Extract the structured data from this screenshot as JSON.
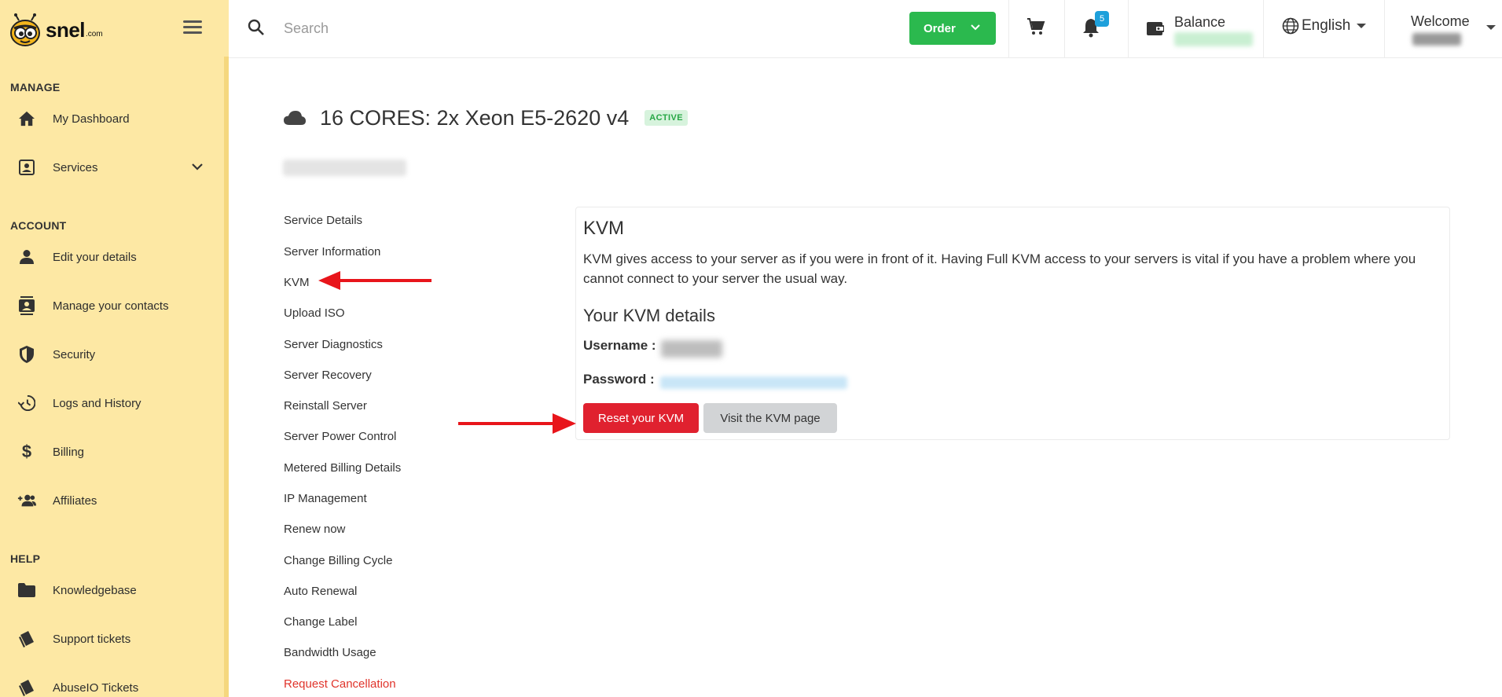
{
  "brand": {
    "name": "snel",
    "tld": ".com"
  },
  "sidebar": {
    "sections": [
      {
        "title": "MANAGE"
      },
      {
        "title": "ACCOUNT"
      },
      {
        "title": "HELP"
      }
    ],
    "items": [
      {
        "label": "My Dashboard",
        "icon": "home-icon"
      },
      {
        "label": "Services",
        "icon": "services-icon"
      },
      {
        "label": "Edit your details",
        "icon": "person-icon"
      },
      {
        "label": "Manage your contacts",
        "icon": "contacts-icon"
      },
      {
        "label": "Security",
        "icon": "shield-icon"
      },
      {
        "label": "Logs and History",
        "icon": "history-icon"
      },
      {
        "label": "Billing",
        "icon": "dollar-icon"
      },
      {
        "label": "Affiliates",
        "icon": "group-add-icon"
      },
      {
        "label": "Knowledgebase",
        "icon": "folder-icon"
      },
      {
        "label": "Support tickets",
        "icon": "tickets-icon"
      },
      {
        "label": "AbuseIO Tickets",
        "icon": "tickets-icon"
      }
    ]
  },
  "topbar": {
    "search_placeholder": "Search",
    "order_label": "Order",
    "notification_count": "5",
    "balance_label": "Balance",
    "language": "English",
    "welcome_label": "Welcome"
  },
  "service": {
    "title": "16 CORES: 2x Xeon E5-2620 v4",
    "status": "ACTIVE"
  },
  "service_nav": [
    "Service Details",
    "Server Information",
    "KVM",
    "Upload ISO",
    "Server Diagnostics",
    "Server Recovery",
    "Reinstall Server",
    "Server Power Control",
    "Metered Billing Details",
    "IP Management",
    "Renew now",
    "Change Billing Cycle",
    "Auto Renewal",
    "Change Label",
    "Bandwidth Usage",
    "Request Cancellation"
  ],
  "kvm": {
    "heading": "KVM",
    "description": "KVM gives access to your server as if you were in front of it. Having Full KVM access to your servers is vital if you have a problem where you cannot connect to your server the usual way.",
    "details_heading": "Your KVM details",
    "username_label": "Username :",
    "password_label": "Password :",
    "reset_button": "Reset your KVM",
    "visit_button": "Visit the KVM page"
  },
  "colors": {
    "sidebar_bg": "#fde8a4",
    "order_green": "#2bb94e",
    "reset_red": "#e0212f",
    "badge_blue": "#1ea0db",
    "annotation_arrow": "#e8151b"
  }
}
